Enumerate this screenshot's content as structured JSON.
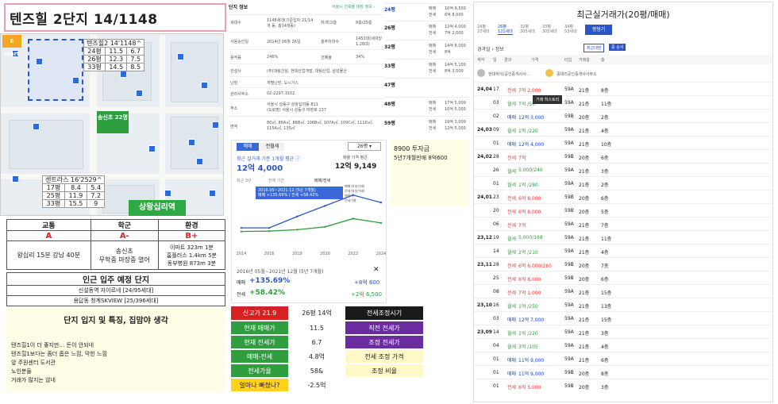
{
  "title": "텐즈힐 2단지 14/1148",
  "map": {
    "mart_label": "E mart",
    "main_table": {
      "header": "텐즈힐2 14'1148^",
      "rows": [
        [
          "24평",
          "11.5",
          "6.7"
        ],
        [
          "26평",
          "12.3",
          "7.5"
        ],
        [
          "33평",
          "14.5",
          "8.5"
        ]
      ]
    },
    "sub_table": {
      "header": "센트라스 16'2529^",
      "rows": [
        [
          "17평",
          "8.4",
          "5.4"
        ],
        [
          "25평",
          "11.9",
          "7.2"
        ],
        [
          "33평",
          "15.5",
          "9"
        ]
      ]
    },
    "school_label": "송신초 22명",
    "station_label": "상왕십리역"
  },
  "grades": {
    "headers": [
      "교통",
      "학군",
      "환경"
    ],
    "grades": [
      "A",
      "A-",
      "B+"
    ],
    "details": [
      "왕십리 15분 강남 40분",
      "송신초\n무학중 마장중 열어",
      "이마트 323m 1분\n홈플러스 1.4km 5분\n동부병원 873m 3분"
    ]
  },
  "supply": {
    "title": "인근 입주 예정 단지",
    "items": [
      "신설동역 자이르네 [24/95세대]",
      "용답동 청계SKVIEW [25/396세대]"
    ]
  },
  "opinion": {
    "title": "단지 입지 및 특징, 집맘야 생각",
    "lines": [
      "텐즈힐1이 더 좋지만… 돈이 안되네",
      "텐즈힐1보다는 좀더 좁은 느낌, 막힌 느낌",
      "앞 주원센터 도서관",
      "노인분들",
      "거래가 많지는 않네"
    ]
  },
  "detail": {
    "heading": "단지 정보",
    "link": "서울시 건축물 대장 정보 ›",
    "rows": [
      {
        "k": "세대수",
        "v": "1148세대(기준입자 21/14개 동, 총14개동)",
        "k2": "저/최고층",
        "v2": "8층/25층"
      },
      {
        "k": "사용승인일",
        "v": "2014년 06월 26일",
        "k2": "총주차대수",
        "v2": "1453대(세대당 1.26대)"
      },
      {
        "k": "용적률",
        "v": "246%",
        "k2": "건폐율",
        "v2": "34%"
      },
      {
        "k": "건설사",
        "v": "(주)대림건설, 현대산업개발, 대림산업, 삼성물산"
      },
      {
        "k": "난방",
        "v": "개별난방, 도시가스"
      },
      {
        "k": "관리사무소",
        "v": "02-2297-3102"
      },
      {
        "k": "주소",
        "v": "서울시 성동구 상왕십리동 811\n(도로명) 서울시 성동구 마장로 137"
      },
      {
        "k": "면적",
        "v": "80㎡, 86A㎡, 86B㎡, 106B㎡, 107A㎡, 109C㎡, 111D㎡, 115A㎡, 135㎡"
      }
    ]
  },
  "listings": [
    {
      "sz": "24평",
      "st": "매매",
      "p": "10억 9,500",
      "s2": "전세",
      "p2": "6억 8,000"
    },
    {
      "sz": "26평",
      "st": "매매",
      "p": "12억 4,000",
      "s2": "전세",
      "p2": "7억 2,000"
    },
    {
      "sz": "32평",
      "st": "매매",
      "p": "14억 8,000",
      "s2": "전세",
      "p2": "8억"
    },
    {
      "sz": "33평",
      "st": "매매",
      "p": "14억 5,100",
      "s2": "전세",
      "p2": "8억 3,500"
    },
    {
      "sz": "47평",
      "st": "매매",
      "p": "",
      "s2": "전세",
      "p2": ""
    },
    {
      "sz": "48평",
      "st": "매매",
      "p": "17억 5,000",
      "s2": "전세",
      "p2": "10억 5,000"
    },
    {
      "sz": "59평",
      "st": "매매",
      "p": "19억 3,000",
      "s2": "전세",
      "p2": "12억 5,000"
    }
  ],
  "chart": {
    "tabs": [
      "매매",
      "전월세"
    ],
    "size_select": "26평 ▾",
    "subtitle": "최근 실거래 기준 1개월 평균 ⓘ",
    "price": "12억 4,000",
    "avg_label": "매물 가격 평균",
    "price_right": "12억 9,149",
    "ranges": [
      "최근 3년",
      "전체 기간",
      "매매/전세"
    ],
    "tooltip": "2016.05~2021.12 (5년 7개월)",
    "tooltip_val": "매매 +135.69% / 전세 +58.42%",
    "legend": [
      "매매가(실거래)",
      "전세가(실거래)",
      "매물가",
      "전세가율"
    ],
    "xlabels": [
      "2014",
      "2016",
      "2018",
      "2020",
      "2022",
      "2024"
    ],
    "period": "2016년 05월~2021년 12월 (5년 7개월)",
    "sale_label": "매매",
    "sale_pct": "+135.69%",
    "sale_amt": "+8억 600",
    "rent_label": "전세",
    "rent_pct": "+58.42%",
    "rent_amt": "+2억 6,500",
    "chart_data": {
      "type": "line",
      "x": [
        "2014",
        "2016",
        "2018",
        "2020",
        "2022",
        "2024"
      ],
      "series": [
        {
          "name": "매매",
          "values": [
            5.3,
            5.3,
            8.5,
            11.5,
            14.5,
            12.4
          ]
        },
        {
          "name": "전세",
          "values": [
            4.3,
            4.4,
            4.8,
            5.6,
            7.9,
            6.7
          ]
        }
      ]
    }
  },
  "invest": {
    "title": "8900 투자금",
    "line": "5년7개월만에 8억600"
  },
  "summary": [
    {
      "a": "신고가 21.9",
      "b": "26평 14억",
      "c": "전세조정시기"
    },
    {
      "a": "현재 매매가",
      "b": "11.5",
      "c": "직전 전세가"
    },
    {
      "a": "현재 전세가",
      "b": "6.7",
      "c": "조정 전세가"
    },
    {
      "a": "매매-전세",
      "b": "4.8억",
      "c": "전세 조정 가격"
    },
    {
      "a": "전세가율",
      "b": "58&",
      "c": "조정 비율"
    },
    {
      "a": "얼마나 빠졌나?",
      "b": "-2.5억",
      "c": ""
    }
  ],
  "right": {
    "title": "최근실거래가(20평/매매)",
    "size_tabs": [
      {
        "l": "24평",
        "s": "27세대"
      },
      {
        "l": "26평",
        "s": "121세대"
      },
      {
        "l": "32평",
        "s": "205세대"
      },
      {
        "l": "33평",
        "s": "305세대"
      },
      {
        "l": "34평",
        "s": "53세대"
      }
    ],
    "avg_button": "평형기",
    "breadcrumb": "경과일 › 정보",
    "chips": [
      "최근대방",
      "중 순서"
    ],
    "cols": [
      "계약",
      "일",
      "경과",
      "가격",
      "타입",
      "거래층",
      "층"
    ],
    "agent": "현대하이(공인중개사사...",
    "agent2": "중대리공인중개사사무소",
    "tooltip": "거래 히스토리",
    "rows": [
      {
        "ym": "24,04",
        "d": "17",
        "t": "전세",
        "p": "7억 2,000",
        "ty": "59A",
        "f": "21층",
        "c": "8층"
      },
      {
        "ym": "",
        "d": "03",
        "t": "월세",
        "p": "7억 /50",
        "ty": "59A",
        "f": "21층",
        "c": "11층"
      },
      {
        "ym": "",
        "d": "02",
        "t": "매매",
        "p": "12억 3,000",
        "ty": "59B",
        "f": "20층",
        "c": "2층"
      },
      {
        "ym": "24,03",
        "d": "09",
        "t": "월세",
        "p": "1억 /220",
        "ty": "59A",
        "f": "21층",
        "c": "4층"
      },
      {
        "ym": "",
        "d": "01",
        "t": "매매",
        "p": "12억 4,000",
        "ty": "59A",
        "f": "21층",
        "c": "10층"
      },
      {
        "ym": "24,02",
        "d": "28",
        "t": "전세",
        "p": "7억",
        "ty": "59B",
        "f": "20층",
        "c": "6층"
      },
      {
        "ym": "",
        "d": "26",
        "t": "월세",
        "p": "5,000/240",
        "ty": "59A",
        "f": "21층",
        "c": "3층"
      },
      {
        "ym": "",
        "d": "01",
        "t": "월세",
        "p": "1억 /280",
        "ty": "59A",
        "f": "21층",
        "c": "2층"
      },
      {
        "ym": "24,01",
        "d": "23",
        "t": "전세",
        "p": "6억 8,000",
        "ty": "59B",
        "f": "20층",
        "c": "6층"
      },
      {
        "ym": "",
        "d": "20",
        "t": "전세",
        "p": "6억 8,000",
        "ty": "59B",
        "f": "20층",
        "c": "5층"
      },
      {
        "ym": "",
        "d": "06",
        "t": "전세",
        "p": "7억",
        "ty": "59A",
        "f": "21층",
        "c": "7층"
      },
      {
        "ym": "23,12",
        "d": "19",
        "t": "월세",
        "p": "5,000/168",
        "ty": "59A",
        "f": "21층",
        "c": "11층"
      },
      {
        "ym": "",
        "d": "14",
        "t": "월세",
        "p": "2억 /210",
        "ty": "59A",
        "f": "21층",
        "c": "4층"
      },
      {
        "ym": "23,11",
        "d": "28",
        "t": "전세",
        "p": "6억 6,000/260",
        "ty": "59B",
        "f": "20층",
        "c": "7층"
      },
      {
        "ym": "",
        "d": "25",
        "t": "전세",
        "p": "6억 8,000",
        "ty": "59B",
        "f": "20층",
        "c": "6층"
      },
      {
        "ym": "",
        "d": "08",
        "t": "전세",
        "p": "7억 1,000",
        "ty": "59A",
        "f": "21층",
        "c": "15층"
      },
      {
        "ym": "23,10",
        "d": "16",
        "t": "월세",
        "p": "1억 /250",
        "ty": "59A",
        "f": "21층",
        "c": "13층"
      },
      {
        "ym": "",
        "d": "03",
        "t": "매매",
        "p": "12억 7,000",
        "ty": "59A",
        "f": "21층",
        "c": "15층"
      },
      {
        "ym": "23,09",
        "d": "14",
        "t": "월세",
        "p": "1억 /220",
        "ty": "59A",
        "f": "21층",
        "c": "3층"
      },
      {
        "ym": "",
        "d": "04",
        "t": "월세",
        "p": "3억 /105",
        "ty": "59A",
        "f": "21층",
        "c": "4층"
      },
      {
        "ym": "",
        "d": "01",
        "t": "매매",
        "p": "11억 9,000",
        "ty": "59A",
        "f": "21층",
        "c": "6층"
      },
      {
        "ym": "",
        "d": "01",
        "t": "매매",
        "p": "11억 9,000",
        "ty": "59B",
        "f": "20층",
        "c": "8층"
      },
      {
        "ym": "",
        "d": "01",
        "t": "전세",
        "p": "6억 5,000",
        "ty": "59B",
        "f": "20층",
        "c": "3층"
      }
    ]
  },
  "colors": {
    "sale": "#2a55c5",
    "rent": "#2f9e3f",
    "red": "#e0202a",
    "purple": "#6a2ca0",
    "dark": "#1a1a1a"
  }
}
